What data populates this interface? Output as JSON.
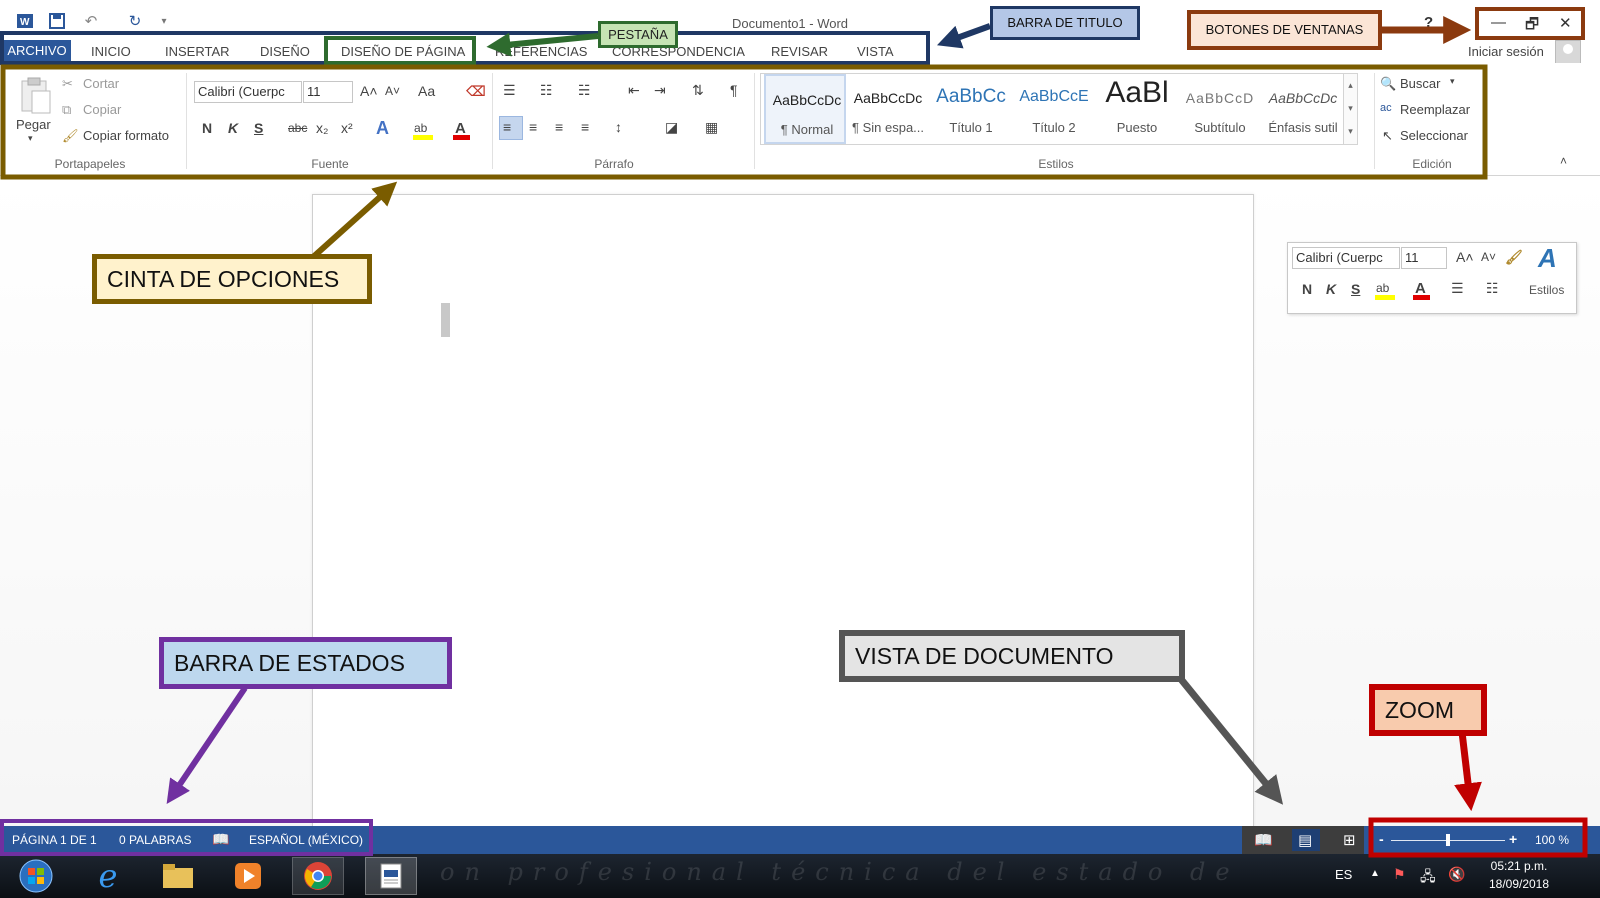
{
  "title_bar": {
    "document_title": "Documento1 - Word",
    "help": "?",
    "win_min": "—",
    "win_restore": "🗗",
    "win_close": "✕",
    "qat_icons": [
      "word-logo-icon",
      "save-icon",
      "undo-icon",
      "redo-icon",
      "customize-qat-icon"
    ]
  },
  "tabs": [
    {
      "id": "archivo",
      "label": "ARCHIVO"
    },
    {
      "id": "inicio",
      "label": "INICIO"
    },
    {
      "id": "insertar",
      "label": "INSERTAR"
    },
    {
      "id": "diseno",
      "label": "DISEÑO"
    },
    {
      "id": "diseno-pagina",
      "label": "DISEÑO DE PÁGINA"
    },
    {
      "id": "referencias",
      "label": "REFERENCIAS"
    },
    {
      "id": "correspondencia",
      "label": "CORRESPONDENCIA"
    },
    {
      "id": "revisar",
      "label": "REVISAR"
    },
    {
      "id": "vista",
      "label": "VISTA"
    }
  ],
  "account": {
    "signin": "Iniciar sesión"
  },
  "ribbon": {
    "clipboard": {
      "paste": "Pegar",
      "cut": "Cortar",
      "copy": "Copiar",
      "format_painter": "Copiar formato",
      "label": "Portapapeles"
    },
    "font": {
      "font_name": "Calibri (Cuerpc",
      "font_size": "11",
      "grow": "A˄",
      "shrink": "A˅",
      "case": "Aa",
      "bold": "N",
      "italic": "K",
      "underline": "S",
      "strike": "abc",
      "sub": "x₂",
      "sup": "x²",
      "label": "Fuente"
    },
    "paragraph": {
      "label": "Párrafo"
    },
    "styles": {
      "label": "Estilos",
      "items": [
        {
          "sample": "AaBbCcDc",
          "name": "¶ Normal"
        },
        {
          "sample": "AaBbCcDc",
          "name": "¶ Sin espa..."
        },
        {
          "sample": "AaBbCc",
          "name": "Título 1"
        },
        {
          "sample": "AaBbCcE",
          "name": "Título 2"
        },
        {
          "sample": "AaBl",
          "name": "Puesto"
        },
        {
          "sample": "AaBbCcD",
          "name": "Subtítulo"
        },
        {
          "sample": "AaBbCcDc",
          "name": "Énfasis sutil"
        }
      ]
    },
    "editing": {
      "find": "Buscar",
      "replace": "Reemplazar",
      "select": "Seleccionar",
      "label": "Edición"
    }
  },
  "mini_toolbar": {
    "font_name": "Calibri (Cuerpc",
    "font_size": "11",
    "bold": "N",
    "italic": "K",
    "underline": "S",
    "styles": "Estilos"
  },
  "status_bar": {
    "page": "PÁGINA 1 DE 1",
    "words": "0 PALABRAS",
    "language": "ESPAÑOL (MÉXICO)",
    "zoom": "100 %",
    "zoom_minus": "-",
    "zoom_plus": "+"
  },
  "taskbar": {
    "lang": "ES",
    "time": "05:21 p.m.",
    "date": "18/09/2018",
    "wallpaper_text": "on profesional técnica del estado de"
  },
  "annotations": {
    "pestana": "PESTAÑA",
    "barra_titulo": "BARRA DE TITULO",
    "botones_ventanas": "BOTONES DE VENTANAS",
    "cinta_opciones": "CINTA DE OPCIONES",
    "barra_estados": "BARRA DE ESTADOS",
    "vista_documento": "VISTA DE DOCUMENTO",
    "zoom": "ZOOM"
  },
  "colors": {
    "word_blue": "#2b579a",
    "ribbon_box": "#7a5c00",
    "tab_box": "#1f3864",
    "pestana_box": "#2e6b2e",
    "window_buttons_box": "#8b3a0f",
    "status_box": "#7030a0",
    "view_box": "#555555",
    "zoom_box": "#c00000"
  }
}
